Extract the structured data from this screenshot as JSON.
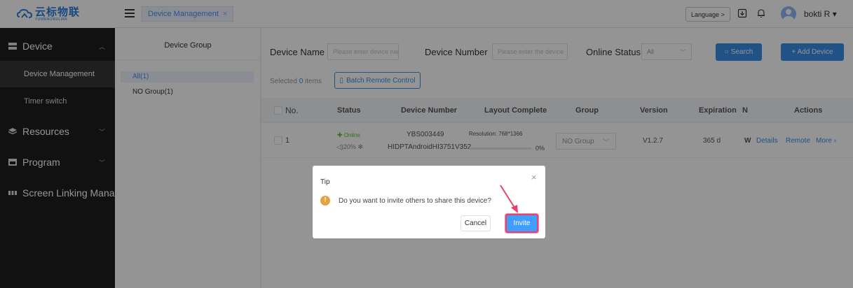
{
  "header": {
    "logo_cn": "云标物联",
    "logo_en": "YUNBIAOWULIAN",
    "open_tab": "Device Management",
    "language_button": "Language",
    "username": "bokti R"
  },
  "sidebar": {
    "items": [
      {
        "label": "Device",
        "icon": "server-icon",
        "expanded": true
      },
      {
        "label": "Device Management",
        "sub": true,
        "active": true
      },
      {
        "label": "Timer switch",
        "sub": true
      },
      {
        "label": "Resources",
        "icon": "layers-icon"
      },
      {
        "label": "Program",
        "icon": "calendar-icon"
      },
      {
        "label": "Screen Linking Mana",
        "icon": "grid-icon"
      }
    ]
  },
  "group_panel": {
    "title": "Device Group",
    "groups": [
      "All(1)",
      "NO Group(1)"
    ]
  },
  "filters": {
    "device_name_label": "Device Name",
    "device_name_placeholder": "Please enter device nar",
    "device_number_label": "Device Number",
    "device_number_placeholder": "Please enter the device",
    "online_status_label": "Online Status",
    "online_status_value": "All",
    "search_button": "Search",
    "add_button": "+ Add Device"
  },
  "toolbar": {
    "selected_prefix": "Selected",
    "selected_count": "0",
    "selected_suffix": "items",
    "batch_button": "Batch Remote Control"
  },
  "table": {
    "columns": [
      "No.",
      "Status",
      "Device Number",
      "Layout Complete",
      "Group",
      "Version",
      "Expiration",
      "N",
      "Actions"
    ],
    "rows": [
      {
        "no": "1",
        "status": "Online",
        "volume": "20%",
        "device_number": "YBS003449",
        "device_model": "HIDPTAndroidHI3751V352",
        "resolution": "Resolution: 768*1366",
        "layout_percent": "0%",
        "layout_progress": 0,
        "group": "NO Group",
        "version": "V1.2.7",
        "expiration": "365 d",
        "n": "W",
        "actions": [
          "Details",
          "Remote",
          "More"
        ]
      }
    ]
  },
  "dialog": {
    "title": "Tip",
    "message": "Do you want to invite others to share this device?",
    "cancel": "Cancel",
    "confirm": "Invite"
  },
  "colors": {
    "primary": "#3a8ee6",
    "sidebar_bg": "#1e1e1e",
    "warning": "#e6a23c",
    "highlight": "#e8416b",
    "online": "#52c41a"
  }
}
